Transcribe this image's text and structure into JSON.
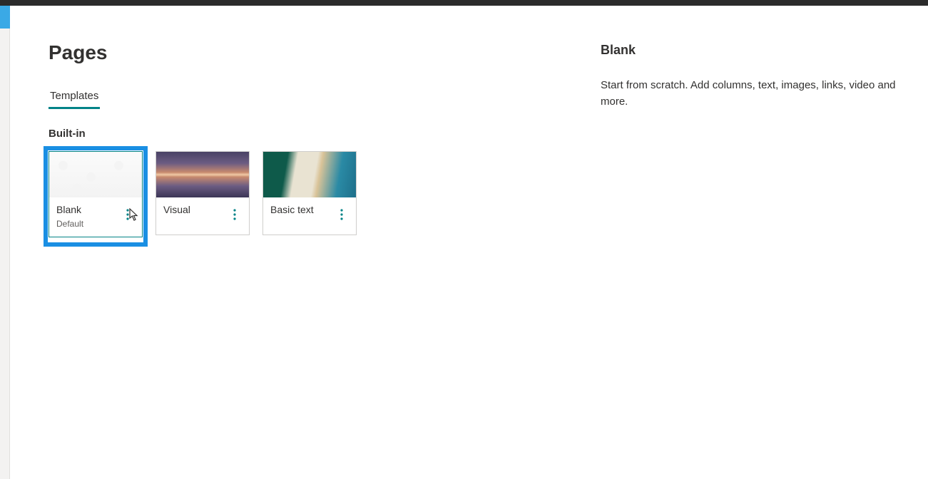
{
  "header": {
    "title": "Pages"
  },
  "tabs": {
    "templates": "Templates"
  },
  "section": {
    "builtin_label": "Built-in"
  },
  "cards": {
    "blank": {
      "title": "Blank",
      "subtitle": "Default"
    },
    "visual": {
      "title": "Visual"
    },
    "basic": {
      "title": "Basic text"
    }
  },
  "detail": {
    "title": "Blank",
    "description": "Start from scratch. Add columns, text, images, links, video and more."
  }
}
